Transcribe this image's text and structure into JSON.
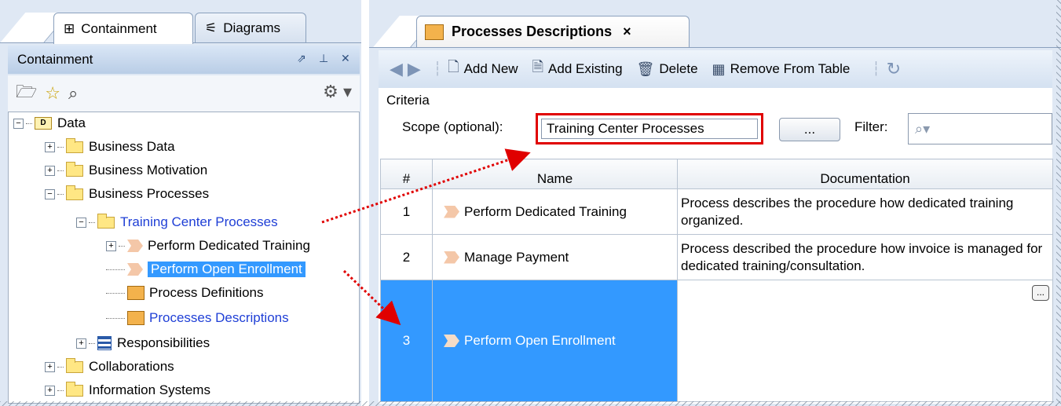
{
  "left_panel": {
    "tabs": [
      {
        "label": "Containment",
        "icon": "containment-tree-icon"
      },
      {
        "label": "Diagrams",
        "icon": "diagrams-icon"
      }
    ],
    "header_title": "Containment",
    "tree": {
      "root": "Data",
      "business_data": "Business Data",
      "business_motivation": "Business Motivation",
      "business_processes": "Business Processes",
      "training_center_processes": "Training Center Processes",
      "perform_dedicated_training": "Perform Dedicated Training",
      "perform_open_enrollment": "Perform Open Enrollment",
      "process_definitions": "Process Definitions",
      "processes_descriptions": "Processes Descriptions",
      "responsibilities": "Responsibilities",
      "collaborations": "Collaborations",
      "information_systems": "Information Systems"
    }
  },
  "right_panel": {
    "tab_title": "Processes Descriptions",
    "tab_close": "×",
    "toolbar": {
      "add_new": "Add New",
      "add_existing": "Add Existing",
      "delete": "Delete",
      "remove_from_table": "Remove From Table"
    },
    "criteria": {
      "title": "Criteria",
      "scope_label": "Scope (optional):",
      "scope_value": "Training Center Processes",
      "browse_label": "...",
      "filter_label": "Filter:"
    },
    "table": {
      "columns": [
        "#",
        "Name",
        "Documentation"
      ],
      "rows": [
        {
          "num": "1",
          "name": "Perform Dedicated Training",
          "doc": "Process describes the procedure how dedicated training organized."
        },
        {
          "num": "2",
          "name": "Manage Payment",
          "doc": "Process described the procedure how invoice is managed for dedicated training/consultation."
        },
        {
          "num": "3",
          "name": "Perform Open Enrollment",
          "doc": ""
        }
      ],
      "cell_button_label": "..."
    }
  },
  "colors": {
    "selection": "#3399ff",
    "highlight_box": "#e00000",
    "link_text": "#1f3fd6"
  }
}
